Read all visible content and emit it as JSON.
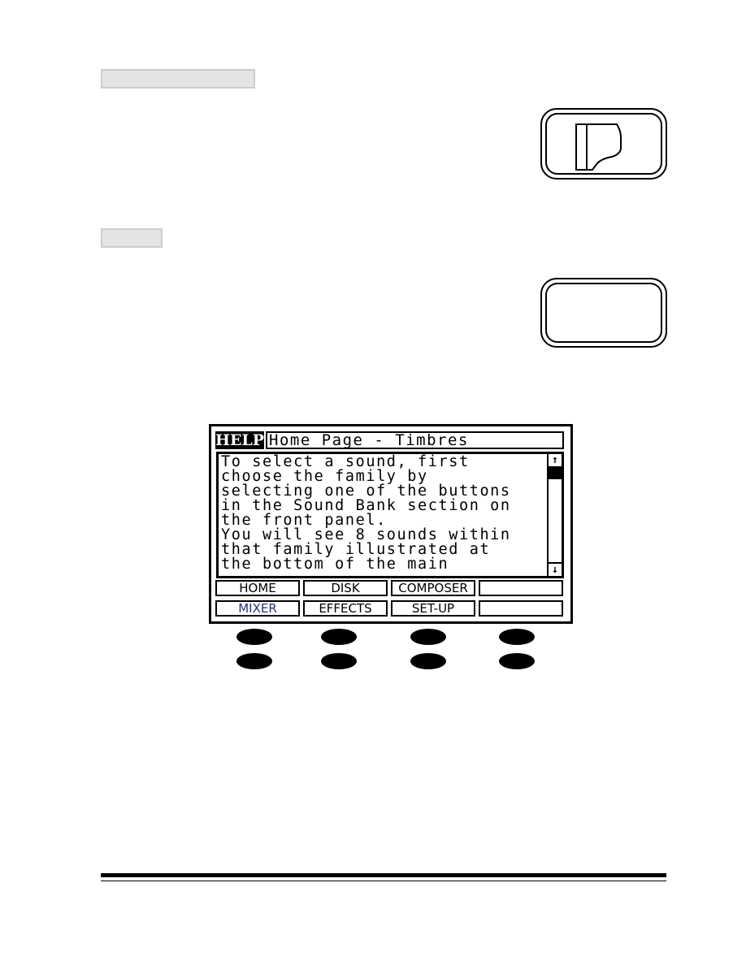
{
  "section_labels": [
    "",
    ""
  ],
  "panel_buttons": [
    {
      "name": "piano-button",
      "icon": "grand-piano-icon"
    },
    {
      "name": "blank-button",
      "icon": ""
    }
  ],
  "display": {
    "logo": "HELP",
    "title": "Home Page - Timbres",
    "help_lines": [
      "To select a sound, first",
      "choose the family by",
      "selecting one of the buttons",
      "in the Sound Bank section on",
      "the front panel.",
      "You will see 8 sounds within",
      "that family illustrated at",
      "the bottom of the main"
    ],
    "scroll_up_icon": "🠅",
    "scroll_down_icon": "🠇",
    "scroll_up": "↑",
    "scroll_down": "↓",
    "soft_buttons_row1": [
      "HOME",
      "DISK",
      "COMPOSER",
      ""
    ],
    "soft_buttons_row2": [
      "MIXER",
      "EFFECTS",
      "SET-UP",
      ""
    ]
  },
  "hardware_buttons": {
    "rows": 2,
    "columns": 4
  }
}
